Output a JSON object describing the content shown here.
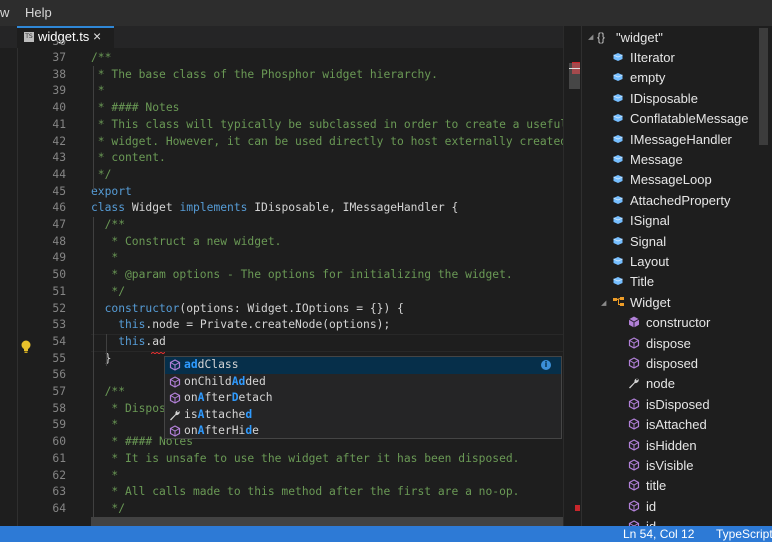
{
  "menubar": {
    "items": [
      "w",
      "Help"
    ]
  },
  "tab": {
    "icon": "typescript-file-icon",
    "icon_text": "TS",
    "label": "widget.ts",
    "close": "×"
  },
  "editor": {
    "partial_top_line": "36",
    "lines": [
      {
        "num": "37",
        "indent": 0,
        "parts": [
          {
            "t": "/**",
            "c": "com"
          }
        ]
      },
      {
        "num": "38",
        "indent": 0,
        "parts": [
          {
            "t": " * The base class of the Phosphor widget hierarchy.",
            "c": "com"
          }
        ]
      },
      {
        "num": "39",
        "indent": 0,
        "parts": [
          {
            "t": " *",
            "c": "com"
          }
        ]
      },
      {
        "num": "40",
        "indent": 0,
        "parts": [
          {
            "t": " * #### Notes",
            "c": "com"
          }
        ]
      },
      {
        "num": "41",
        "indent": 0,
        "parts": [
          {
            "t": " * This class will typically be subclassed in order to create a useful",
            "c": "com"
          }
        ]
      },
      {
        "num": "42",
        "indent": 0,
        "parts": [
          {
            "t": " * widget. However, it can be used directly to host externally created",
            "c": "com"
          }
        ]
      },
      {
        "num": "43",
        "indent": 0,
        "parts": [
          {
            "t": " * content.",
            "c": "com"
          }
        ]
      },
      {
        "num": "44",
        "indent": 0,
        "parts": [
          {
            "t": " */",
            "c": "com"
          }
        ]
      },
      {
        "num": "45",
        "indent": 0,
        "parts": [
          {
            "t": "export",
            "c": "kw"
          }
        ]
      },
      {
        "num": "46",
        "indent": 0,
        "parts": [
          {
            "t": "class",
            "c": "kw"
          },
          {
            "t": " Widget ",
            "c": "id"
          },
          {
            "t": "implements",
            "c": "kw"
          },
          {
            "t": " IDisposable, IMessageHandler {",
            "c": "id"
          }
        ]
      },
      {
        "num": "47",
        "indent": 1,
        "parts": [
          {
            "t": "/**",
            "c": "com"
          }
        ]
      },
      {
        "num": "48",
        "indent": 1,
        "parts": [
          {
            "t": " * Construct a new widget.",
            "c": "com"
          }
        ]
      },
      {
        "num": "49",
        "indent": 1,
        "parts": [
          {
            "t": " *",
            "c": "com"
          }
        ]
      },
      {
        "num": "50",
        "indent": 1,
        "parts": [
          {
            "t": " * @param options - The options for initializing the widget.",
            "c": "com"
          }
        ]
      },
      {
        "num": "51",
        "indent": 1,
        "parts": [
          {
            "t": " */",
            "c": "com"
          }
        ]
      },
      {
        "num": "52",
        "indent": 1,
        "parts": [
          {
            "t": "constructor",
            "c": "kw"
          },
          {
            "t": "(options: Widget.IOptions = {}) {",
            "c": "id"
          }
        ]
      },
      {
        "num": "53",
        "indent": 2,
        "parts": [
          {
            "t": "this",
            "c": "kw"
          },
          {
            "t": ".node = Private.createNode(options);",
            "c": "id"
          }
        ]
      },
      {
        "num": "54",
        "indent": 2,
        "parts": [
          {
            "t": "this",
            "c": "kw"
          },
          {
            "t": ".ad",
            "c": "id"
          }
        ],
        "current": true
      },
      {
        "num": "55",
        "indent": 1,
        "parts": [
          {
            "t": "}",
            "c": "id"
          }
        ]
      },
      {
        "num": "56",
        "indent": 0,
        "parts": []
      },
      {
        "num": "57",
        "indent": 1,
        "parts": [
          {
            "t": "/**",
            "c": "com"
          }
        ]
      },
      {
        "num": "58",
        "indent": 1,
        "parts": [
          {
            "t": " * Dispose of the resources held by the widget.",
            "c": "com"
          }
        ]
      },
      {
        "num": "59",
        "indent": 1,
        "parts": [
          {
            "t": " *",
            "c": "com"
          }
        ]
      },
      {
        "num": "60",
        "indent": 1,
        "parts": [
          {
            "t": " * #### Notes",
            "c": "com"
          }
        ]
      },
      {
        "num": "61",
        "indent": 1,
        "parts": [
          {
            "t": " * It is unsafe to use the widget after it has been disposed.",
            "c": "com"
          }
        ]
      },
      {
        "num": "62",
        "indent": 1,
        "parts": [
          {
            "t": " *",
            "c": "com"
          }
        ]
      },
      {
        "num": "63",
        "indent": 1,
        "parts": [
          {
            "t": " * All calls made to this method after the first are a no-op.",
            "c": "com"
          }
        ]
      },
      {
        "num": "64",
        "indent": 1,
        "parts": [
          {
            "t": " */",
            "c": "com"
          }
        ]
      }
    ]
  },
  "suggest": {
    "items": [
      {
        "icon": "method-icon",
        "label": "addClass",
        "match": [
          0,
          1
        ],
        "selected": true,
        "info": "i"
      },
      {
        "icon": "method-icon",
        "label": "onChildAdded",
        "match": [
          7,
          8
        ]
      },
      {
        "icon": "method-icon",
        "label": "onAfterDetach",
        "match": [
          2,
          7
        ]
      },
      {
        "icon": "wrench-icon",
        "label": "isAttached",
        "match": [
          2,
          9
        ]
      },
      {
        "icon": "method-icon",
        "label": "onAfterHide",
        "match": [
          2,
          9
        ]
      }
    ]
  },
  "outline": {
    "root": {
      "icon": "braces-icon",
      "glyph": "{}",
      "label": "\"widget\""
    },
    "items": [
      {
        "label": "IIterator",
        "icon": "module-icon",
        "level": 1
      },
      {
        "label": "empty",
        "icon": "module-icon",
        "level": 1
      },
      {
        "label": "IDisposable",
        "icon": "module-icon",
        "level": 1
      },
      {
        "label": "ConflatableMessage",
        "icon": "module-icon",
        "level": 1
      },
      {
        "label": "IMessageHandler",
        "icon": "module-icon",
        "level": 1
      },
      {
        "label": "Message",
        "icon": "module-icon",
        "level": 1
      },
      {
        "label": "MessageLoop",
        "icon": "module-icon",
        "level": 1
      },
      {
        "label": "AttachedProperty",
        "icon": "module-icon",
        "level": 1
      },
      {
        "label": "ISignal",
        "icon": "module-icon",
        "level": 1
      },
      {
        "label": "Signal",
        "icon": "module-icon",
        "level": 1
      },
      {
        "label": "Layout",
        "icon": "module-icon",
        "level": 1
      },
      {
        "label": "Title",
        "icon": "module-icon",
        "level": 1
      },
      {
        "label": "Widget",
        "icon": "class-icon",
        "level": 1,
        "expanded": true
      },
      {
        "label": "constructor",
        "icon": "constructor-icon",
        "level": 2
      },
      {
        "label": "dispose",
        "icon": "method-icon",
        "level": 2
      },
      {
        "label": "disposed",
        "icon": "method-icon",
        "level": 2
      },
      {
        "label": "node",
        "icon": "wrench-icon",
        "level": 2
      },
      {
        "label": "isDisposed",
        "icon": "method-icon",
        "level": 2
      },
      {
        "label": "isAttached",
        "icon": "method-icon",
        "level": 2
      },
      {
        "label": "isHidden",
        "icon": "method-icon",
        "level": 2
      },
      {
        "label": "isVisible",
        "icon": "method-icon",
        "level": 2
      },
      {
        "label": "title",
        "icon": "method-icon",
        "level": 2
      },
      {
        "label": "id",
        "icon": "method-icon",
        "level": 2
      },
      {
        "label": "id",
        "icon": "method-icon",
        "level": 2
      }
    ]
  },
  "status": {
    "position": "Ln 54, Col 12",
    "language": "TypeScript"
  },
  "colors": {
    "accent": "#2f87d6",
    "status_bar": "#2d7ad6",
    "comment": "#6a9955",
    "keyword": "#569cd6",
    "match": "#2f9bff",
    "error": "#c8262b"
  }
}
